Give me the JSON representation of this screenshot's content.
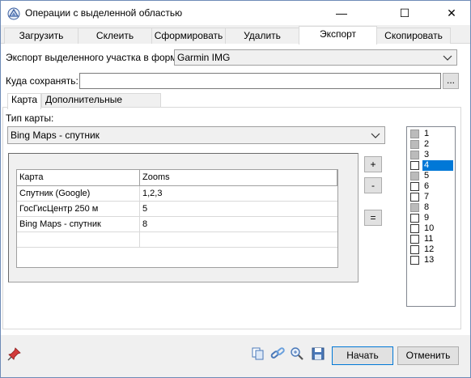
{
  "window": {
    "title": "Операции с выделенной областью",
    "min_glyph": "—",
    "max_glyph": "☐",
    "close_glyph": "✕"
  },
  "tabs": [
    {
      "label": "Загрузить"
    },
    {
      "label": "Склеить"
    },
    {
      "label": "Сформировать"
    },
    {
      "label": "Удалить"
    },
    {
      "label": "Экспорт"
    },
    {
      "label": "Скопировать"
    }
  ],
  "export": {
    "format_label": "Экспорт выделенного участка в формат",
    "format_value": "Garmin IMG",
    "path_label": "Куда сохранять:",
    "path_value": "",
    "browse_label": "..."
  },
  "subtabs": [
    {
      "label": "Карта"
    },
    {
      "label": "Дополнительные операции"
    }
  ],
  "map": {
    "type_label": "Тип карты:",
    "type_value": "Bing Maps - спутник"
  },
  "grid": {
    "headers": [
      "Карта",
      "Zooms"
    ],
    "rows": [
      [
        "Спутник (Google)",
        "1,2,3"
      ],
      [
        "ГосГисЦентр 250 м",
        "5"
      ],
      [
        "Bing Maps - спутник",
        "8"
      ],
      [
        "",
        ""
      ]
    ]
  },
  "side_buttons": {
    "add": "+",
    "remove": "-",
    "equal": "="
  },
  "zooms": [
    {
      "label": "1",
      "checked": true
    },
    {
      "label": "2",
      "checked": true
    },
    {
      "label": "3",
      "checked": true
    },
    {
      "label": "4",
      "checked": false
    },
    {
      "label": "5",
      "checked": true
    },
    {
      "label": "6",
      "checked": false
    },
    {
      "label": "7",
      "checked": false
    },
    {
      "label": "8",
      "checked": true
    },
    {
      "label": "9",
      "checked": false
    },
    {
      "label": "10",
      "checked": false
    },
    {
      "label": "11",
      "checked": false
    },
    {
      "label": "12",
      "checked": false
    },
    {
      "label": "13",
      "checked": false
    }
  ],
  "footer": {
    "start_label": "Начать",
    "cancel_label": "Отменить"
  },
  "icons": {
    "app": "app-icon",
    "pin": "pin-icon",
    "copy": "copy-icon",
    "link": "link-icon",
    "search": "search-zoom-icon",
    "save": "save-icon"
  },
  "colors": {
    "selection": "#0078d7",
    "primary_border": "#0078d7"
  }
}
